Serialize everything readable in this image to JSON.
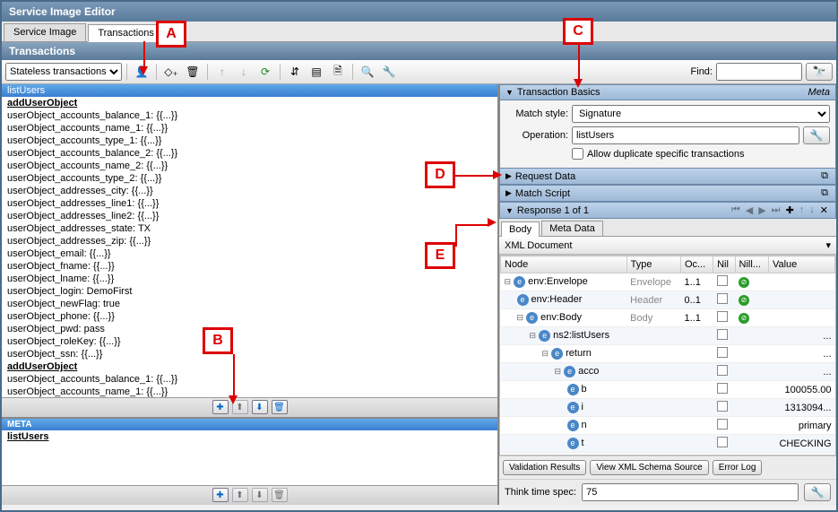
{
  "window": {
    "title": "Service Image Editor"
  },
  "topTabs": {
    "tab1": "Service Image",
    "tab2": "Transactions"
  },
  "section": {
    "title": "Transactions"
  },
  "toolbar": {
    "dropdown": "Stateless transactions",
    "findLabel": "Find:",
    "findValue": ""
  },
  "tree": {
    "selected": "listUsers",
    "group1": "addUserObject",
    "rows": [
      "userObject_accounts_balance_1: {{...}}",
      "userObject_accounts_name_1: {{...}}",
      "userObject_accounts_type_1: {{...}}",
      "userObject_accounts_balance_2: {{...}}",
      "userObject_accounts_name_2: {{...}}",
      "userObject_accounts_type_2: {{...}}",
      "userObject_addresses_city: {{...}}",
      "userObject_addresses_line1: {{...}}",
      "userObject_addresses_line2: {{...}}",
      "userObject_addresses_state: TX",
      "userObject_addresses_zip: {{...}}",
      "userObject_email: {{...}}",
      "userObject_fname: {{...}}",
      "userObject_lname: {{...}}",
      "userObject_login: DemoFirst",
      "userObject_newFlag: true",
      "userObject_phone: {{...}}",
      "userObject_pwd: pass",
      "userObject_roleKey: {{...}}",
      "userObject_ssn: {{...}}"
    ],
    "group2": "addUserObject",
    "rows2": [
      "userObject_accounts_balance_1: {{...}}",
      "userObject_accounts_name_1: {{...}}"
    ]
  },
  "meta": {
    "header": "META",
    "row": "listUsers"
  },
  "right": {
    "panel1": {
      "title": "Transaction Basics",
      "metaLabel": "Meta"
    },
    "form": {
      "matchStyleLabel": "Match style:",
      "matchStyleValue": "Signature",
      "operationLabel": "Operation:",
      "operationValue": "listUsers",
      "allowDupLabel": "Allow duplicate specific transactions"
    },
    "panel2": "Request Data",
    "panel3": "Match Script",
    "panel4": "Response 1 of 1",
    "subTabs": {
      "body": "Body",
      "meta": "Meta Data"
    },
    "xmlLabel": "XML Document",
    "cols": {
      "node": "Node",
      "type": "Type",
      "occ": "Oc...",
      "nil": "Nil",
      "nill": "Nill...",
      "value": "Value"
    },
    "xmlRows": [
      {
        "indent": 0,
        "expand": "⊟",
        "name": "env:Envelope",
        "type": "Envelope",
        "occ": "1..1",
        "nillGreen": true,
        "value": ""
      },
      {
        "indent": 1,
        "expand": "",
        "name": "env:Header",
        "type": "Header",
        "occ": "0..1",
        "nillGreen": true,
        "value": ""
      },
      {
        "indent": 1,
        "expand": "⊟",
        "name": "env:Body",
        "type": "Body",
        "occ": "1..1",
        "nillGreen": true,
        "value": ""
      },
      {
        "indent": 2,
        "expand": "⊟",
        "name": "ns2:listUsers",
        "type": "",
        "occ": "",
        "nillGreen": false,
        "value": "..."
      },
      {
        "indent": 3,
        "expand": "⊟",
        "name": "return",
        "type": "",
        "occ": "",
        "nillGreen": false,
        "value": "..."
      },
      {
        "indent": 4,
        "expand": "⊟",
        "name": "acco",
        "type": "",
        "occ": "",
        "nillGreen": false,
        "value": "..."
      },
      {
        "indent": 5,
        "expand": "",
        "name": "b",
        "type": "",
        "occ": "",
        "nillGreen": false,
        "value": "100055.00"
      },
      {
        "indent": 5,
        "expand": "",
        "name": "i",
        "type": "",
        "occ": "",
        "nillGreen": false,
        "value": "1313094..."
      },
      {
        "indent": 5,
        "expand": "",
        "name": "n",
        "type": "",
        "occ": "",
        "nillGreen": false,
        "value": "primary"
      },
      {
        "indent": 5,
        "expand": "",
        "name": "t",
        "type": "",
        "occ": "",
        "nillGreen": false,
        "value": "CHECKING"
      }
    ],
    "buttons": {
      "validate": "Validation Results",
      "schema": "View XML Schema Source",
      "errlog": "Error Log"
    },
    "think": {
      "label": "Think time spec:",
      "value": "75"
    }
  },
  "callouts": {
    "A": "A",
    "B": "B",
    "C": "C",
    "D": "D",
    "E": "E"
  }
}
